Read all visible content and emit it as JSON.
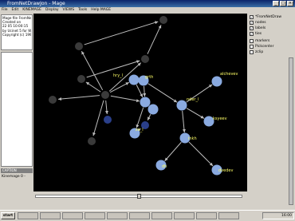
{
  "window": {
    "title": "FromNetDrawJon - Mage",
    "controls": [
      "minimize-icon",
      "maximize-icon",
      "close-icon"
    ]
  },
  "menu": {
    "items": [
      "File",
      "Edit",
      "KINEMAGE",
      "Display",
      "VIEWS",
      "Tools",
      "Help MAGE"
    ]
  },
  "info": {
    "lines": [
      "Mage file FromNetDraw",
      "Created on",
      "22 05 10:00:15",
      "by Ucinet 5 for Windows",
      "Copyright (c) 1999-2005"
    ]
  },
  "caption": {
    "label": "CAPTION"
  },
  "kinemage": {
    "label": "Kinemage 0 -"
  },
  "controls": {
    "checkboxes": [
      {
        "label": "*FromNetDraw",
        "checked": true
      },
      {
        "label": "nodes",
        "checked": true
      },
      {
        "label": "labels",
        "checked": true
      },
      {
        "label": "ties",
        "checked": true
      },
      {
        "label": "markers",
        "checked": false
      },
      {
        "label": "Pickcenter",
        "checked": false
      },
      {
        "label": "zclip",
        "checked": false
      }
    ]
  },
  "network": {
    "background": "#000000",
    "edge_color": "#bfbfbf",
    "node_colors": {
      "foreground": "#8aaae0",
      "dim": "#2a3f8a",
      "dark": "#3a3a3a"
    },
    "label_color": "#ffff66",
    "labels": [
      "alchevev",
      "nder_l",
      "ksyeev",
      "inkh",
      "dh",
      "dvedev",
      "ze_l",
      "grth",
      "hry_l"
    ]
  },
  "taskbar": {
    "start_label": "start",
    "clock": "16:00"
  }
}
